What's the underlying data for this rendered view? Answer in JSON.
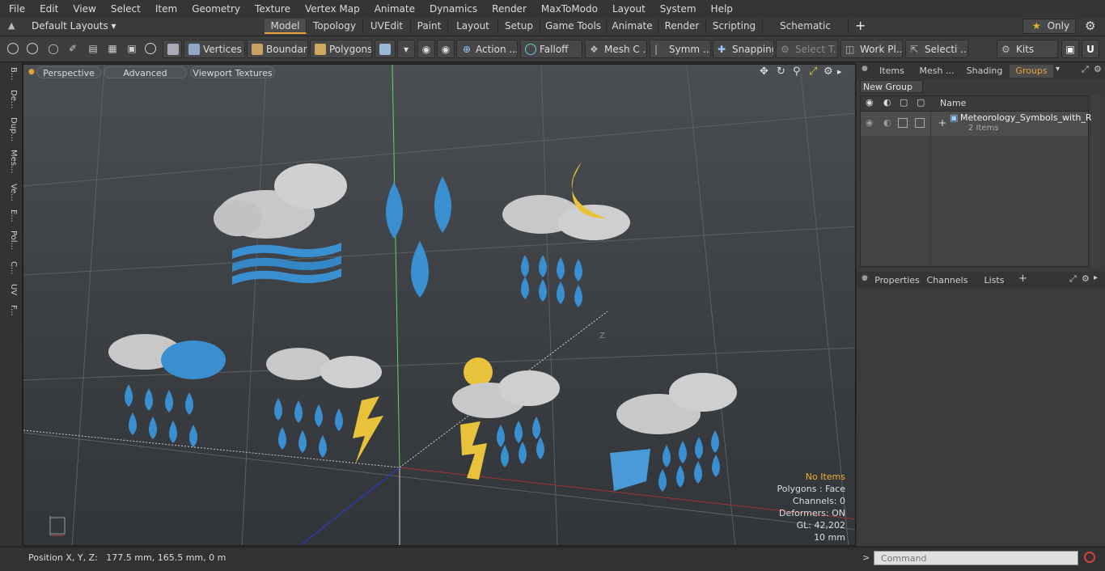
{
  "menu": [
    "File",
    "Edit",
    "View",
    "Select",
    "Item",
    "Geometry",
    "Texture",
    "Vertex Map",
    "Animate",
    "Dynamics",
    "Render",
    "MaxToModo",
    "Layout",
    "System",
    "Help"
  ],
  "layout_bar": {
    "layouts_label": "Default Layouts",
    "tabs": [
      "Model",
      "Topology",
      "UVEdit",
      "Paint",
      "Layout",
      "Setup",
      "Game Tools",
      "Animate",
      "Render",
      "Scripting",
      "Schematic Fusion"
    ],
    "active_tab": "Model",
    "only_label": "Only"
  },
  "toolbar": {
    "vertices": "Vertices",
    "boundary": "Boundary",
    "polygons": "Polygons",
    "action": "Action ...",
    "falloff": "Falloff",
    "mesh": "Mesh C ...",
    "symmetry": "Symm ...",
    "snapping": "Snapping",
    "select_t": "Select T...",
    "work_plane": "Work Pl...",
    "selection": "Selecti ...",
    "kits": "Kits"
  },
  "left_tabs": [
    "B...",
    "De...",
    "Dup...",
    "Mes...",
    "Ve...",
    "E...",
    "Pol...",
    "C...",
    "UV",
    "F..."
  ],
  "viewport": {
    "perspective": "Perspective",
    "advanced": "Advanced",
    "textures": "Viewport Textures",
    "axis_label": "Z",
    "info": {
      "no_items": "No Items",
      "polygons": "Polygons : Face",
      "channels": "Channels: 0",
      "deformers": "Deformers: ON",
      "gl": "GL: 42,202",
      "scale": "10 mm"
    }
  },
  "right_top": {
    "tabs": [
      "Items",
      "Mesh ...",
      "Shading",
      "Groups"
    ],
    "active_tab": "Groups",
    "new_group": "New Group",
    "col_name": "Name",
    "group_name": "Meteorology_Symbols_with_R...",
    "group_count": "2 Items"
  },
  "right_bottom": {
    "tabs": [
      "Properties",
      "Channels",
      "Lists"
    ],
    "active_tab": "Properties"
  },
  "status": {
    "position": "Position X, Y, Z:   177.5 mm, 165.5 mm, 0 m",
    "command_placeholder": "Command"
  },
  "colors": {
    "accent": "#e8a33b",
    "blue_symbol": "#3a8fd0",
    "yellow_symbol": "#e8c23a",
    "cloud": "#c8c8c8"
  }
}
